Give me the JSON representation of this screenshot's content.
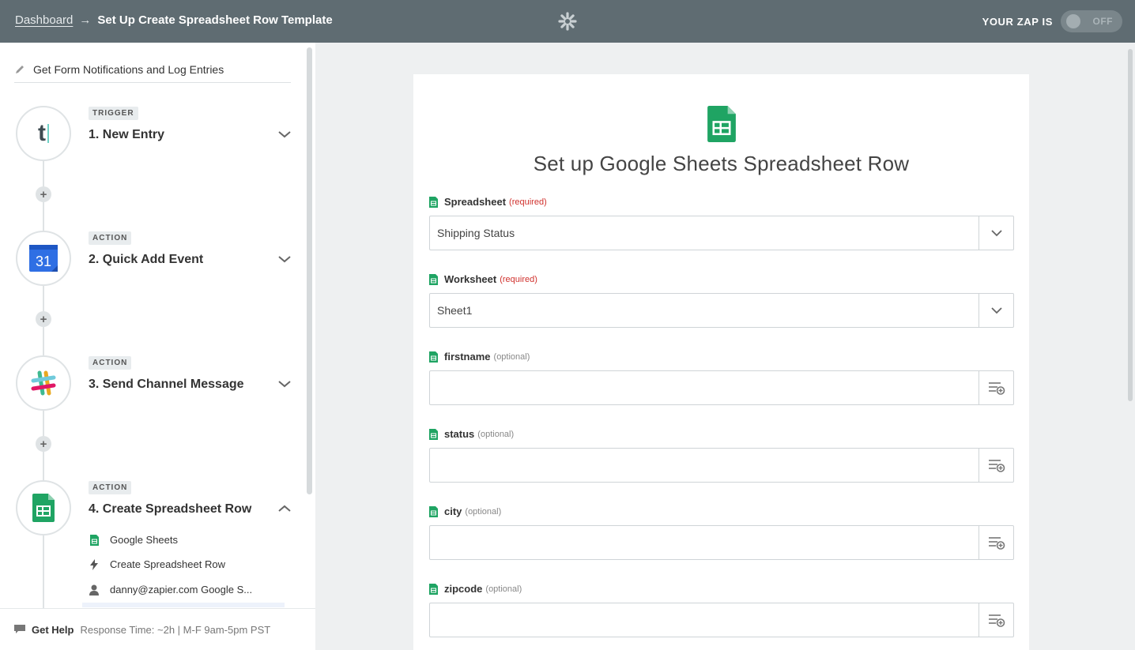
{
  "topbar": {
    "dashboard_link": "Dashboard",
    "arrow": "→",
    "page_title": "Set Up Create Spreadsheet Row Template",
    "zap_status_label": "YOUR ZAP IS",
    "toggle_label": "OFF"
  },
  "sidebar": {
    "zap_name": "Get Form Notifications and Log Entries",
    "steps": [
      {
        "tag": "TRIGGER",
        "title": "1. New Entry",
        "icon": "typeform-icon"
      },
      {
        "tag": "ACTION",
        "title": "2. Quick Add Event",
        "icon": "google-calendar-icon",
        "calendar_day": "31"
      },
      {
        "tag": "ACTION",
        "title": "3. Send Channel Message",
        "icon": "slack-icon"
      },
      {
        "tag": "ACTION",
        "title": "4. Create Spreadsheet Row",
        "icon": "google-sheets-icon"
      }
    ],
    "typeform_letter": "t",
    "plus": "+",
    "sub_items": [
      {
        "icon": "google-sheets-icon",
        "label": "Google Sheets"
      },
      {
        "icon": "lightning-icon",
        "label": "Create Spreadsheet Row"
      },
      {
        "icon": "user-icon",
        "label": "danny@zapier.com Google S..."
      }
    ],
    "footer": {
      "help": "Get Help",
      "response": "Response Time: ~2h | M-F 9am-5pm PST"
    }
  },
  "main": {
    "title": "Set up Google Sheets Spreadsheet Row",
    "fields": [
      {
        "name": "Spreadsheet",
        "hint": "(required)",
        "value": "Shipping Status",
        "kind": "dropdown"
      },
      {
        "name": "Worksheet",
        "hint": "(required)",
        "value": "Sheet1",
        "kind": "dropdown"
      },
      {
        "name": "firstname",
        "hint": "(optional)",
        "value": "",
        "kind": "text"
      },
      {
        "name": "status",
        "hint": "(optional)",
        "value": "",
        "kind": "text"
      },
      {
        "name": "city",
        "hint": "(optional)",
        "value": "",
        "kind": "text"
      },
      {
        "name": "zipcode",
        "hint": "(optional)",
        "value": "",
        "kind": "text"
      }
    ]
  },
  "colors": {
    "topbar": "#5f6c72",
    "sheets_green": "#1fa463",
    "required_red": "#d0312d",
    "calendar_blue": "#2f6fe4"
  }
}
